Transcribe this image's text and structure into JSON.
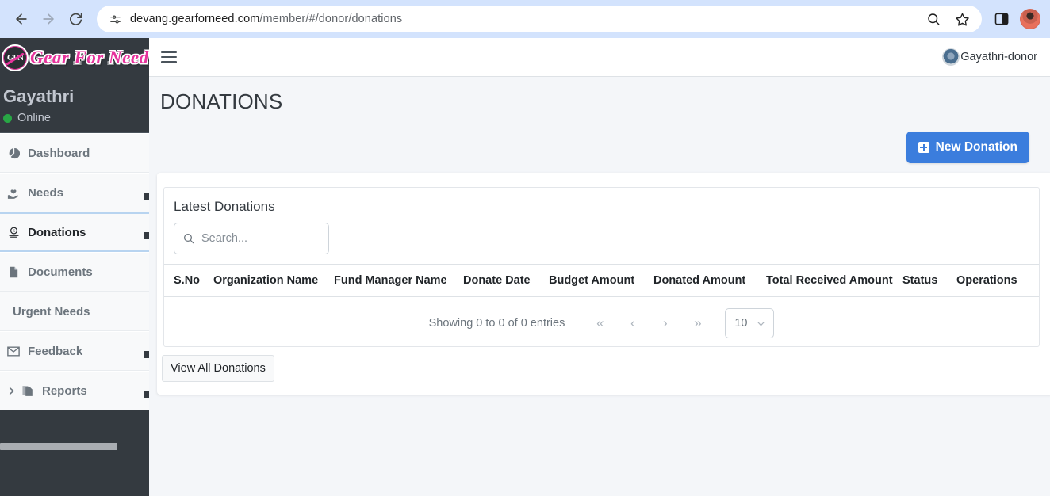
{
  "browser": {
    "url_host": "devang.gearforneed.com",
    "url_path": "/member/#/donor/donations",
    "back_icon": "back-arrow-icon",
    "forward_icon": "forward-arrow-icon",
    "reload_icon": "reload-icon",
    "site_info_icon": "tune-settings-icon",
    "zoom_icon": "search-magnifier-icon",
    "bookmark_icon": "star-icon",
    "side_panel_icon": "side-panel-icon",
    "profile_icon": "profile-avatar-icon"
  },
  "sidebar": {
    "brand": {
      "badge_text": "GFN",
      "name": "Gear For Need"
    },
    "user": {
      "name": "Gayathri",
      "status": "Online",
      "status_color": "#28a745"
    },
    "items": [
      {
        "label": "Dashboard",
        "icon": "pie-chart-icon",
        "active": false,
        "has_caret": false
      },
      {
        "label": "Needs",
        "icon": "hands-heart-icon",
        "active": false,
        "has_caret": false
      },
      {
        "label": "Donations",
        "icon": "donation-icon",
        "active": true,
        "has_caret": false
      },
      {
        "label": "Documents",
        "icon": "document-icon",
        "active": false,
        "has_caret": false
      },
      {
        "label": "Urgent Needs",
        "icon": "",
        "active": false,
        "has_caret": false
      },
      {
        "label": "Feedback",
        "icon": "envelope-icon",
        "active": false,
        "has_caret": false
      },
      {
        "label": "Reports",
        "icon": "copy-files-icon",
        "active": false,
        "has_caret": true
      }
    ]
  },
  "topbar": {
    "menu_icon": "hamburger-menu-icon",
    "user_label": "Gayathri-donor",
    "avatar_icon": "user-avatar-icon"
  },
  "page": {
    "title": "DONATIONS",
    "new_donation_label": "New Donation",
    "new_donation_icon": "plus-square-icon",
    "accent_color": "#3b7ddd"
  },
  "card": {
    "title": "Latest Donations",
    "search": {
      "placeholder": "Search...",
      "value": "",
      "icon": "search-icon"
    },
    "columns": [
      "S.No",
      "Organization Name",
      "Fund Manager Name",
      "Donate Date",
      "Budget Amount",
      "Donated Amount",
      "Total Received Amount",
      "Status",
      "Operations"
    ],
    "rows": [],
    "pagination": {
      "info": "Showing 0 to 0 of 0 entries",
      "first_icon": "«",
      "prev_icon": "‹",
      "next_icon": "›",
      "last_icon": "»",
      "page_size": "10",
      "page_size_chevron": "chevron-down-icon"
    },
    "view_all_label": "View All Donations"
  }
}
